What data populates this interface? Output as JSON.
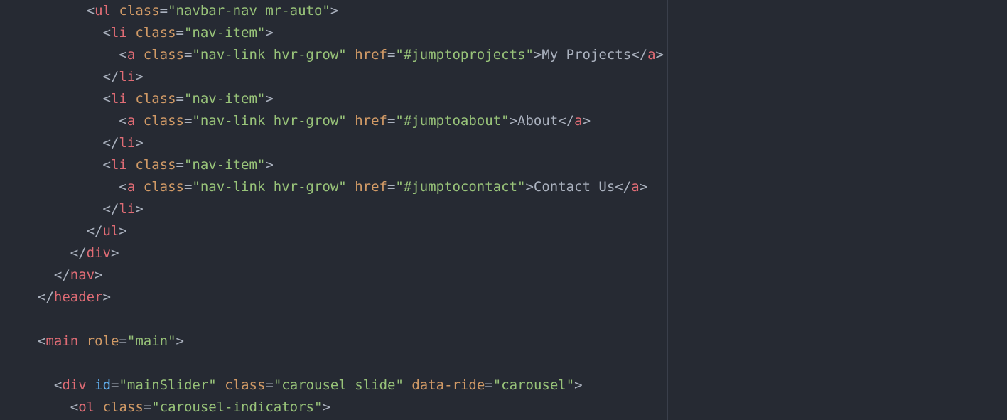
{
  "editor": {
    "colors": {
      "background": "#262a33",
      "tag": "#e06c75",
      "attribute": "#d19a66",
      "id_attribute": "#61afef",
      "string": "#98c379",
      "text": "#abb2bf",
      "wrap_guide": "#3a3f4b"
    },
    "lines": [
      {
        "indent": 3,
        "tokens": [
          {
            "t": "punct",
            "v": "<"
          },
          {
            "t": "tag",
            "v": "ul"
          },
          {
            "t": "text",
            "v": " "
          },
          {
            "t": "attr",
            "v": "class"
          },
          {
            "t": "punct",
            "v": "="
          },
          {
            "t": "str",
            "v": "\"navbar-nav mr-auto\""
          },
          {
            "t": "punct",
            "v": ">"
          }
        ]
      },
      {
        "indent": 4,
        "tokens": [
          {
            "t": "punct",
            "v": "<"
          },
          {
            "t": "tag",
            "v": "li"
          },
          {
            "t": "text",
            "v": " "
          },
          {
            "t": "attr",
            "v": "class"
          },
          {
            "t": "punct",
            "v": "="
          },
          {
            "t": "str",
            "v": "\"nav-item\""
          },
          {
            "t": "punct",
            "v": ">"
          }
        ]
      },
      {
        "indent": 5,
        "tokens": [
          {
            "t": "punct",
            "v": "<"
          },
          {
            "t": "tag",
            "v": "a"
          },
          {
            "t": "text",
            "v": " "
          },
          {
            "t": "attr",
            "v": "class"
          },
          {
            "t": "punct",
            "v": "="
          },
          {
            "t": "str",
            "v": "\"nav-link hvr-grow\""
          },
          {
            "t": "text",
            "v": " "
          },
          {
            "t": "attr",
            "v": "href"
          },
          {
            "t": "punct",
            "v": "="
          },
          {
            "t": "str",
            "v": "\"#jumptoprojects\""
          },
          {
            "t": "punct",
            "v": ">"
          },
          {
            "t": "text",
            "v": "My Projects"
          },
          {
            "t": "punct",
            "v": "</"
          },
          {
            "t": "tag",
            "v": "a"
          },
          {
            "t": "punct",
            "v": ">"
          }
        ]
      },
      {
        "indent": 4,
        "tokens": [
          {
            "t": "punct",
            "v": "</"
          },
          {
            "t": "tag",
            "v": "li"
          },
          {
            "t": "punct",
            "v": ">"
          }
        ]
      },
      {
        "indent": 4,
        "tokens": [
          {
            "t": "punct",
            "v": "<"
          },
          {
            "t": "tag",
            "v": "li"
          },
          {
            "t": "text",
            "v": " "
          },
          {
            "t": "attr",
            "v": "class"
          },
          {
            "t": "punct",
            "v": "="
          },
          {
            "t": "str",
            "v": "\"nav-item\""
          },
          {
            "t": "punct",
            "v": ">"
          }
        ]
      },
      {
        "indent": 5,
        "tokens": [
          {
            "t": "punct",
            "v": "<"
          },
          {
            "t": "tag",
            "v": "a"
          },
          {
            "t": "text",
            "v": " "
          },
          {
            "t": "attr",
            "v": "class"
          },
          {
            "t": "punct",
            "v": "="
          },
          {
            "t": "str",
            "v": "\"nav-link hvr-grow\""
          },
          {
            "t": "text",
            "v": " "
          },
          {
            "t": "attr",
            "v": "href"
          },
          {
            "t": "punct",
            "v": "="
          },
          {
            "t": "str",
            "v": "\"#jumptoabout\""
          },
          {
            "t": "punct",
            "v": ">"
          },
          {
            "t": "text",
            "v": "About"
          },
          {
            "t": "punct",
            "v": "</"
          },
          {
            "t": "tag",
            "v": "a"
          },
          {
            "t": "punct",
            "v": ">"
          }
        ]
      },
      {
        "indent": 4,
        "tokens": [
          {
            "t": "punct",
            "v": "</"
          },
          {
            "t": "tag",
            "v": "li"
          },
          {
            "t": "punct",
            "v": ">"
          }
        ]
      },
      {
        "indent": 4,
        "tokens": [
          {
            "t": "punct",
            "v": "<"
          },
          {
            "t": "tag",
            "v": "li"
          },
          {
            "t": "text",
            "v": " "
          },
          {
            "t": "attr",
            "v": "class"
          },
          {
            "t": "punct",
            "v": "="
          },
          {
            "t": "str",
            "v": "\"nav-item\""
          },
          {
            "t": "punct",
            "v": ">"
          }
        ]
      },
      {
        "indent": 5,
        "tokens": [
          {
            "t": "punct",
            "v": "<"
          },
          {
            "t": "tag",
            "v": "a"
          },
          {
            "t": "text",
            "v": " "
          },
          {
            "t": "attr",
            "v": "class"
          },
          {
            "t": "punct",
            "v": "="
          },
          {
            "t": "str",
            "v": "\"nav-link hvr-grow\""
          },
          {
            "t": "text",
            "v": " "
          },
          {
            "t": "attr",
            "v": "href"
          },
          {
            "t": "punct",
            "v": "="
          },
          {
            "t": "str",
            "v": "\"#jumptocontact\""
          },
          {
            "t": "punct",
            "v": ">"
          },
          {
            "t": "text",
            "v": "Contact Us"
          },
          {
            "t": "punct",
            "v": "</"
          },
          {
            "t": "tag",
            "v": "a"
          },
          {
            "t": "punct",
            "v": ">"
          }
        ]
      },
      {
        "indent": 4,
        "tokens": [
          {
            "t": "punct",
            "v": "</"
          },
          {
            "t": "tag",
            "v": "li"
          },
          {
            "t": "punct",
            "v": ">"
          }
        ]
      },
      {
        "indent": 3,
        "tokens": [
          {
            "t": "punct",
            "v": "</"
          },
          {
            "t": "tag",
            "v": "ul"
          },
          {
            "t": "punct",
            "v": ">"
          }
        ]
      },
      {
        "indent": 2,
        "tokens": [
          {
            "t": "punct",
            "v": "</"
          },
          {
            "t": "tag",
            "v": "div"
          },
          {
            "t": "punct",
            "v": ">"
          }
        ]
      },
      {
        "indent": 1,
        "tokens": [
          {
            "t": "punct",
            "v": "</"
          },
          {
            "t": "tag",
            "v": "nav"
          },
          {
            "t": "punct",
            "v": ">"
          }
        ]
      },
      {
        "indent": 0,
        "tokens": [
          {
            "t": "punct",
            "v": "</"
          },
          {
            "t": "tag",
            "v": "header"
          },
          {
            "t": "punct",
            "v": ">"
          }
        ]
      },
      {
        "indent": 0,
        "tokens": []
      },
      {
        "indent": 0,
        "tokens": [
          {
            "t": "punct",
            "v": "<"
          },
          {
            "t": "tag",
            "v": "main"
          },
          {
            "t": "text",
            "v": " "
          },
          {
            "t": "attr",
            "v": "role"
          },
          {
            "t": "punct",
            "v": "="
          },
          {
            "t": "str",
            "v": "\"main\""
          },
          {
            "t": "punct",
            "v": ">"
          }
        ]
      },
      {
        "indent": 0,
        "tokens": []
      },
      {
        "indent": 1,
        "tokens": [
          {
            "t": "punct",
            "v": "<"
          },
          {
            "t": "tag",
            "v": "div"
          },
          {
            "t": "text",
            "v": " "
          },
          {
            "t": "id-attr",
            "v": "id"
          },
          {
            "t": "punct",
            "v": "="
          },
          {
            "t": "str",
            "v": "\"mainSlider\""
          },
          {
            "t": "text",
            "v": " "
          },
          {
            "t": "attr",
            "v": "class"
          },
          {
            "t": "punct",
            "v": "="
          },
          {
            "t": "str",
            "v": "\"carousel slide\""
          },
          {
            "t": "text",
            "v": " "
          },
          {
            "t": "attr",
            "v": "data-ride"
          },
          {
            "t": "punct",
            "v": "="
          },
          {
            "t": "str",
            "v": "\"carousel\""
          },
          {
            "t": "punct",
            "v": ">"
          }
        ]
      },
      {
        "indent": 2,
        "tokens": [
          {
            "t": "punct",
            "v": "<"
          },
          {
            "t": "tag",
            "v": "ol"
          },
          {
            "t": "text",
            "v": " "
          },
          {
            "t": "attr",
            "v": "class"
          },
          {
            "t": "punct",
            "v": "="
          },
          {
            "t": "str",
            "v": "\"carousel-indicators\""
          },
          {
            "t": "punct",
            "v": ">"
          }
        ]
      }
    ]
  }
}
